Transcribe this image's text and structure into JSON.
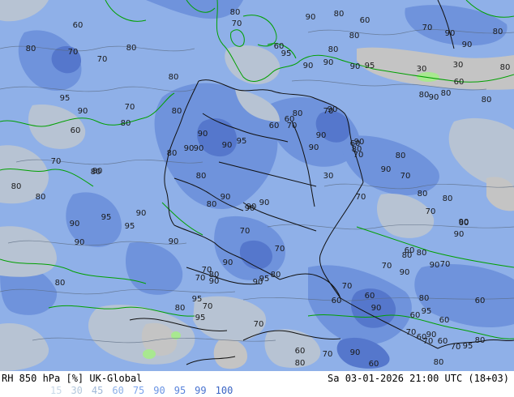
{
  "footer": {
    "product": "RH 850 hPa [%] UK-Global",
    "valid_time": "Sa 03-01-2026 21:00 UTC (18+03)"
  },
  "legend": {
    "levels": [
      {
        "label": "15",
        "color": "#c8d8e8"
      },
      {
        "label": "30",
        "color": "#b4c8dc"
      },
      {
        "label": "45",
        "color": "#a0b8d8"
      },
      {
        "label": "60",
        "color": "#8cb0e8"
      },
      {
        "label": "75",
        "color": "#7ca4ec"
      },
      {
        "label": "90",
        "color": "#6a94e4"
      },
      {
        "label": "95",
        "color": "#5a84dc"
      },
      {
        "label": "99",
        "color": "#4a74d0"
      },
      {
        "label": "100",
        "color": "#3a64c4"
      }
    ]
  },
  "colors": {
    "field_moist": "#8fb0e8",
    "field_very_moist": "#6f93dc",
    "field_saturated": "#5577cc",
    "field_dry": "#b7c3d3",
    "field_very_dry": "#c4c4c4",
    "coast": "#00a000",
    "border": "#101010"
  },
  "contour_labels": [
    {
      "text": "80"
    },
    {
      "text": "70"
    },
    {
      "text": "90"
    },
    {
      "text": "60"
    },
    {
      "text": "80"
    },
    {
      "text": "70"
    },
    {
      "text": "70"
    },
    {
      "text": "80"
    },
    {
      "text": "80"
    },
    {
      "text": "95"
    },
    {
      "text": "90"
    },
    {
      "text": "70"
    },
    {
      "text": "80"
    },
    {
      "text": "60"
    },
    {
      "text": "80"
    },
    {
      "text": "90"
    },
    {
      "text": "90"
    },
    {
      "text": "80"
    },
    {
      "text": "90"
    },
    {
      "text": "95"
    },
    {
      "text": "80"
    },
    {
      "text": "60"
    },
    {
      "text": "90"
    },
    {
      "text": "80"
    },
    {
      "text": "80"
    },
    {
      "text": "95"
    },
    {
      "text": "90"
    },
    {
      "text": "95"
    },
    {
      "text": "90"
    },
    {
      "text": "90"
    },
    {
      "text": "80"
    },
    {
      "text": "70"
    },
    {
      "text": "80"
    },
    {
      "text": "90"
    },
    {
      "text": "90"
    },
    {
      "text": "80"
    },
    {
      "text": "70"
    },
    {
      "text": "90"
    },
    {
      "text": "90"
    },
    {
      "text": "70"
    },
    {
      "text": "80"
    },
    {
      "text": "90"
    },
    {
      "text": "90"
    },
    {
      "text": "90"
    },
    {
      "text": "70"
    },
    {
      "text": "80"
    },
    {
      "text": "70"
    },
    {
      "text": "90"
    },
    {
      "text": "60"
    },
    {
      "text": "70"
    },
    {
      "text": "90"
    },
    {
      "text": "60"
    },
    {
      "text": "70"
    },
    {
      "text": "80"
    },
    {
      "text": "90"
    },
    {
      "text": "80"
    },
    {
      "text": "90"
    },
    {
      "text": "70"
    },
    {
      "text": "80"
    },
    {
      "text": "80"
    },
    {
      "text": "70"
    },
    {
      "text": "70"
    },
    {
      "text": "90"
    },
    {
      "text": "90"
    },
    {
      "text": "70"
    },
    {
      "text": "90"
    },
    {
      "text": "60"
    },
    {
      "text": "90"
    },
    {
      "text": "80"
    },
    {
      "text": "80"
    },
    {
      "text": "60"
    },
    {
      "text": "70"
    },
    {
      "text": "70"
    },
    {
      "text": "95"
    },
    {
      "text": "60"
    },
    {
      "text": "60"
    },
    {
      "text": "80"
    },
    {
      "text": "80"
    },
    {
      "text": "60"
    },
    {
      "text": "70"
    },
    {
      "text": "90"
    },
    {
      "text": "80"
    },
    {
      "text": "90"
    },
    {
      "text": "60"
    },
    {
      "text": "95"
    },
    {
      "text": "90"
    },
    {
      "text": "90"
    },
    {
      "text": "80"
    },
    {
      "text": "90"
    },
    {
      "text": "95"
    },
    {
      "text": "80"
    },
    {
      "text": "80"
    },
    {
      "text": "90"
    },
    {
      "text": "80"
    },
    {
      "text": "30"
    },
    {
      "text": "60"
    },
    {
      "text": "30"
    },
    {
      "text": "80"
    },
    {
      "text": "30"
    },
    {
      "text": "90"
    },
    {
      "text": "70"
    },
    {
      "text": "60"
    },
    {
      "text": "60"
    },
    {
      "text": "90"
    },
    {
      "text": "80"
    },
    {
      "text": "60"
    },
    {
      "text": "95"
    },
    {
      "text": "90"
    },
    {
      "text": "70"
    },
    {
      "text": "60"
    },
    {
      "text": "80"
    },
    {
      "text": "70"
    },
    {
      "text": "80"
    },
    {
      "text": "60"
    },
    {
      "text": "90"
    },
    {
      "text": "60"
    },
    {
      "text": "70"
    },
    {
      "text": "80"
    },
    {
      "text": "60"
    },
    {
      "text": "80"
    },
    {
      "text": "95"
    },
    {
      "text": "90"
    },
    {
      "text": "80"
    },
    {
      "text": "70"
    },
    {
      "text": "70"
    },
    {
      "text": "95"
    },
    {
      "text": "80"
    },
    {
      "text": "95"
    },
    {
      "text": "70"
    }
  ]
}
